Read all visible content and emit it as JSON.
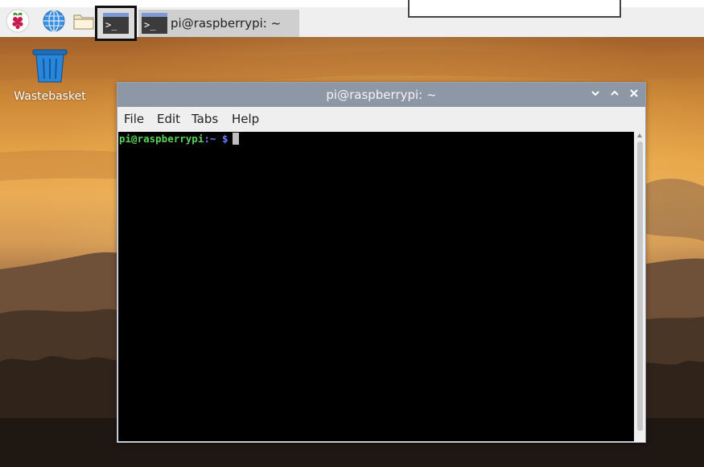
{
  "taskbar": {
    "window_task_label": "pi@raspberrypi: ~",
    "terminal_glyph": ">_"
  },
  "desktop": {
    "wastebasket_label": "Wastebasket"
  },
  "terminal": {
    "title": "pi@raspberrypi: ~",
    "menu": [
      "File",
      "Edit",
      "Tabs",
      "Help"
    ],
    "prompt_user_host": "pi@raspberrypi",
    "prompt_path": ":~",
    "prompt_symbol": "$"
  },
  "colors": {
    "titlebar": "#8e97a6",
    "prompt_user": "#5ad35a",
    "prompt_path": "#6d7dff",
    "terminal_bg": "#000000"
  },
  "icons": {
    "menu": "raspberry-icon",
    "browser": "globe-icon",
    "files": "folder-icon",
    "terminal": "terminal-icon",
    "wastebasket": "trash-icon",
    "minimize": "chevron-down-icon",
    "maximize": "chevron-up-icon",
    "close": "close-icon"
  }
}
